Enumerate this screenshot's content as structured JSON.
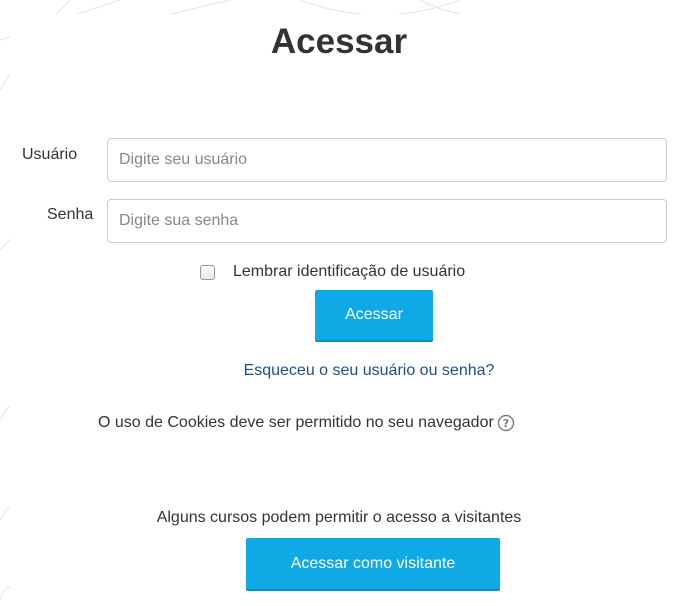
{
  "login": {
    "title": "Acessar",
    "username_label": "Usuário",
    "username_placeholder": "Digite seu usuário",
    "password_label": "Senha",
    "password_placeholder": "Digite sua senha",
    "remember_label": "Lembrar identificação de usuário",
    "remember_checked": false,
    "submit_label": "Acessar",
    "forgot_link": "Esqueceu o seu usuário ou senha?",
    "cookies_notice": "O uso de Cookies deve ser permitido no seu navegador",
    "help_icon": "question-circle-icon",
    "guest_notice": "Alguns cursos podem permitir o acesso a visitantes",
    "guest_button_label": "Acessar como visitante"
  },
  "colors": {
    "button_bg": "#0fa9e6",
    "link": "#1b4f8a",
    "text": "#333333"
  }
}
